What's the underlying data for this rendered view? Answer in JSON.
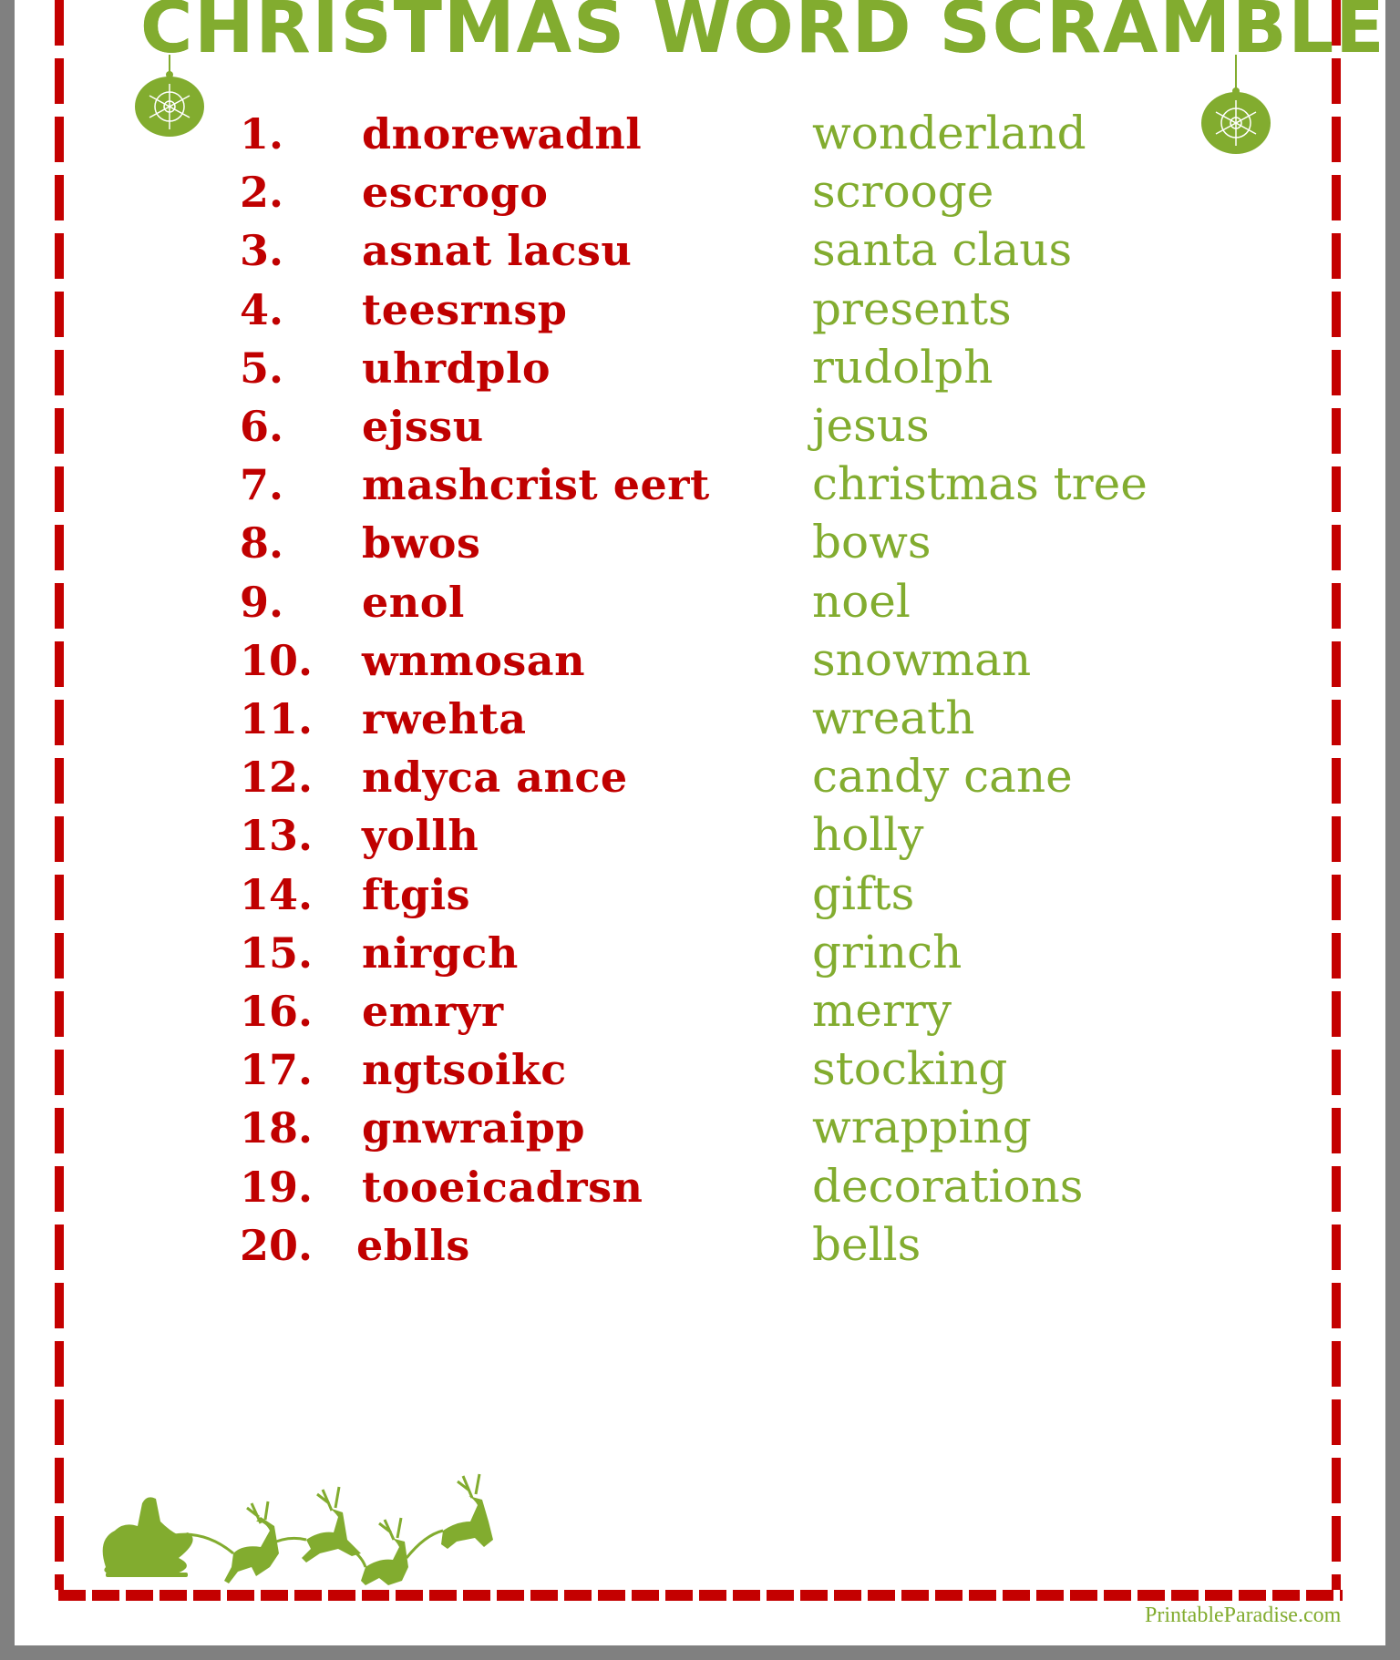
{
  "title": "CHRISTMAS WORD SCRAMBLE",
  "colors": {
    "red": "#c00000",
    "green": "#82ac2f",
    "border": "#c40000",
    "background": "#808080"
  },
  "items": [
    {
      "number": "1.",
      "scrambled": "dnorewadnl",
      "answer": "wonderland"
    },
    {
      "number": "2.",
      "scrambled": "escrogo",
      "answer": "scrooge"
    },
    {
      "number": "3.",
      "scrambled": "asnat lacsu",
      "answer": "santa claus"
    },
    {
      "number": "4.",
      "scrambled": "teesrnsp",
      "answer": "presents"
    },
    {
      "number": "5.",
      "scrambled": "uhrdplo",
      "answer": "rudolph"
    },
    {
      "number": "6.",
      "scrambled": "ejssu",
      "answer": "jesus"
    },
    {
      "number": "7.",
      "scrambled": "mashcrist eert",
      "answer": "christmas tree"
    },
    {
      "number": "8.",
      "scrambled": "bwos",
      "answer": "bows"
    },
    {
      "number": "9.",
      "scrambled": "enol",
      "answer": "noel"
    },
    {
      "number": "10.",
      "scrambled": "wnmosan",
      "answer": "snowman"
    },
    {
      "number": "11.",
      "scrambled": "rwehta",
      "answer": "wreath"
    },
    {
      "number": "12.",
      "scrambled": "ndyca ance",
      "answer": "candy cane"
    },
    {
      "number": "13.",
      "scrambled": "yollh",
      "answer": "holly"
    },
    {
      "number": "14.",
      "scrambled": "ftgis",
      "answer": "gifts"
    },
    {
      "number": "15.",
      "scrambled": "nirgch",
      "answer": "grinch"
    },
    {
      "number": "16.",
      "scrambled": "emryr",
      "answer": "merry"
    },
    {
      "number": "17.",
      "scrambled": "ngtsoikc",
      "answer": "stocking"
    },
    {
      "number": "18.",
      "scrambled": "gnwraipp",
      "answer": "wrapping"
    },
    {
      "number": "19.",
      "scrambled": "tooeicadrsn",
      "answer": "decorations"
    },
    {
      "number": "20.",
      "scrambled": "eblls",
      "answer": "bells"
    }
  ],
  "icons": {
    "ornament": "ornament-icon",
    "sleigh": "santa-sleigh-reindeer-icon"
  },
  "credit": "PrintableParadise.com"
}
